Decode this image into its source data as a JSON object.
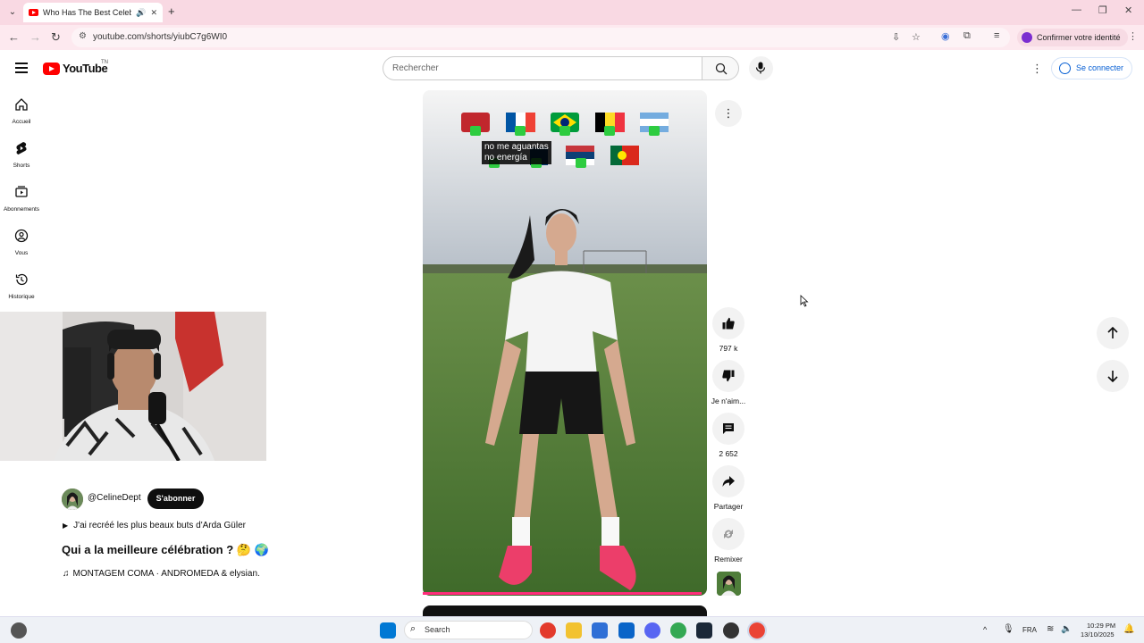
{
  "browser": {
    "tab_title": "Who Has The Best Celebrat",
    "url": "youtube.com/shorts/yiubC7g6WI0",
    "profile_label": "Confirmer votre identité"
  },
  "header": {
    "logo_text": "YouTube",
    "logo_tm": "TN",
    "search_placeholder": "Rechercher",
    "signin_label": "Se connecter"
  },
  "sidebar": {
    "items": [
      {
        "label": "Accueil",
        "icon": "home-icon"
      },
      {
        "label": "Shorts",
        "icon": "shorts-icon"
      },
      {
        "label": "Abonnements",
        "icon": "subscriptions-icon"
      },
      {
        "label": "Vous",
        "icon": "you-icon"
      },
      {
        "label": "Historique",
        "icon": "history-icon"
      }
    ]
  },
  "short": {
    "caption_line1": "no me aguantas",
    "caption_line2": "no energía",
    "progress_fraction": 0.98
  },
  "channel": {
    "handle": "@CelineDept",
    "subscribe_label": "S'abonner",
    "playlist": "J'ai recréé les plus beaux buts d'Arda Güler",
    "title": "Qui a la meilleure célébration ? 🤔 🌍",
    "music": "MONTAGEM COMA · ANDROMEDA & elysian."
  },
  "actions": {
    "like_count": "797 k",
    "dislike_label": "Je n'aim...",
    "comment_count": "2 652",
    "share_label": "Partager",
    "remix_label": "Remixer"
  },
  "taskbar": {
    "search_label": "Search",
    "lang": "FRA",
    "time": "10:29 PM",
    "date": "13/10/2025"
  },
  "colors": {
    "yt_red": "#ff0000",
    "tab_bg": "#f9d9e3",
    "progress": "#ff2d7b",
    "link_blue": "#065fd4"
  }
}
